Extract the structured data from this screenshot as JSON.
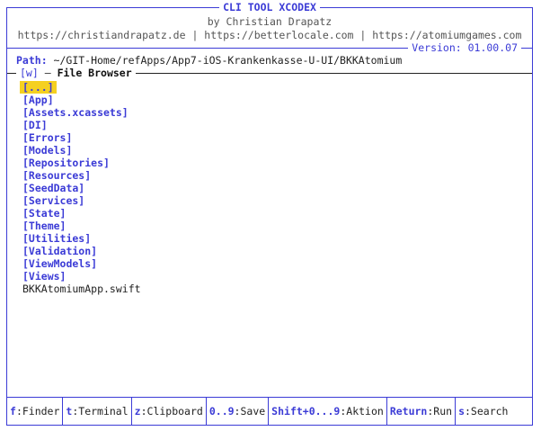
{
  "app": {
    "title": "CLI TOOL XCODEX",
    "author": "by Christian Drapatz",
    "links": "https://christiandrapatz.de | https://betterlocale.com | https://atomiumgames.com",
    "version": "Version: 01.00.07"
  },
  "path": {
    "label": "Path:",
    "value": " ~/GIT-Home/refApps/App7-iOS-Krankenkasse-U-UI/BKKAtomium"
  },
  "file_browser": {
    "key": "[w]",
    "title": "File Browser",
    "items": [
      {
        "label": "[...]",
        "type": "dir",
        "selected": true
      },
      {
        "label": "[App]",
        "type": "dir"
      },
      {
        "label": "[Assets.xcassets]",
        "type": "dir"
      },
      {
        "label": "[DI]",
        "type": "dir"
      },
      {
        "label": "[Errors]",
        "type": "dir"
      },
      {
        "label": "[Models]",
        "type": "dir"
      },
      {
        "label": "[Repositories]",
        "type": "dir"
      },
      {
        "label": "[Resources]",
        "type": "dir"
      },
      {
        "label": "[SeedData]",
        "type": "dir"
      },
      {
        "label": "[Services]",
        "type": "dir"
      },
      {
        "label": "[State]",
        "type": "dir"
      },
      {
        "label": "[Theme]",
        "type": "dir"
      },
      {
        "label": "[Utilities]",
        "type": "dir"
      },
      {
        "label": "[Validation]",
        "type": "dir"
      },
      {
        "label": "[ViewModels]",
        "type": "dir"
      },
      {
        "label": "[Views]",
        "type": "dir"
      },
      {
        "label": "BKKAtomiumApp.swift",
        "type": "file"
      }
    ]
  },
  "shortcuts": [
    {
      "key": "f",
      "label": ":Finder"
    },
    {
      "key": "t",
      "label": ":Terminal"
    },
    {
      "key": "z",
      "label": ":Clipboard"
    },
    {
      "key": "0..9",
      "label": ":Save"
    },
    {
      "key": "Shift+0...9",
      "label": ":Aktion"
    },
    {
      "key": "Return",
      "label": ":Run"
    },
    {
      "key": "s",
      "label": ":Search"
    }
  ],
  "colors": {
    "accent": "#3b3bd6",
    "selection": "#f5d020"
  }
}
